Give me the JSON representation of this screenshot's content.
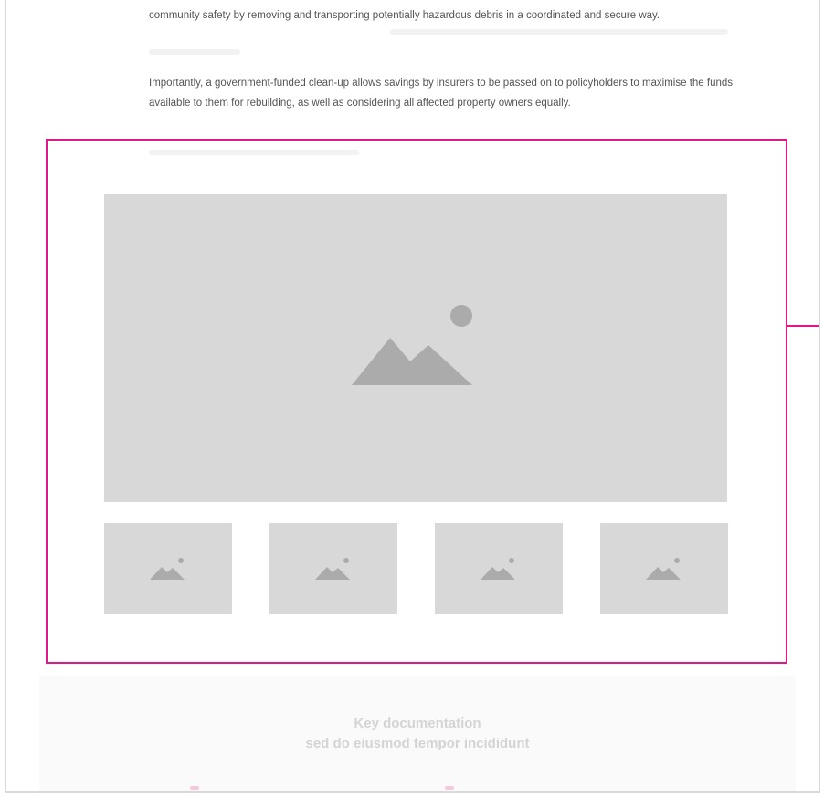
{
  "content": {
    "paragraph_1": "community safety by removing and transporting potentially hazardous debris in a coordinated and secure way.",
    "paragraph_2": "Importantly, a government-funded clean-up allows savings by insurers to be passed on to policyholders to maximise the funds available to them for rebuilding, as well as considering all affected property owners equally."
  },
  "gallery": {
    "main_image_icon": "image-placeholder-icon",
    "thumbnails": [
      {
        "icon": "image-placeholder-icon"
      },
      {
        "icon": "image-placeholder-icon"
      },
      {
        "icon": "image-placeholder-icon"
      },
      {
        "icon": "image-placeholder-icon"
      }
    ]
  },
  "documentation": {
    "title": "Key documentation",
    "subtitle": "sed do eiusmod tempor incididunt"
  },
  "colors": {
    "highlight": "#e0188a",
    "placeholder_bg": "#d8d8d8",
    "placeholder_icon": "#ababab",
    "body_text": "#555555",
    "faded_text": "#d4d4d4"
  }
}
